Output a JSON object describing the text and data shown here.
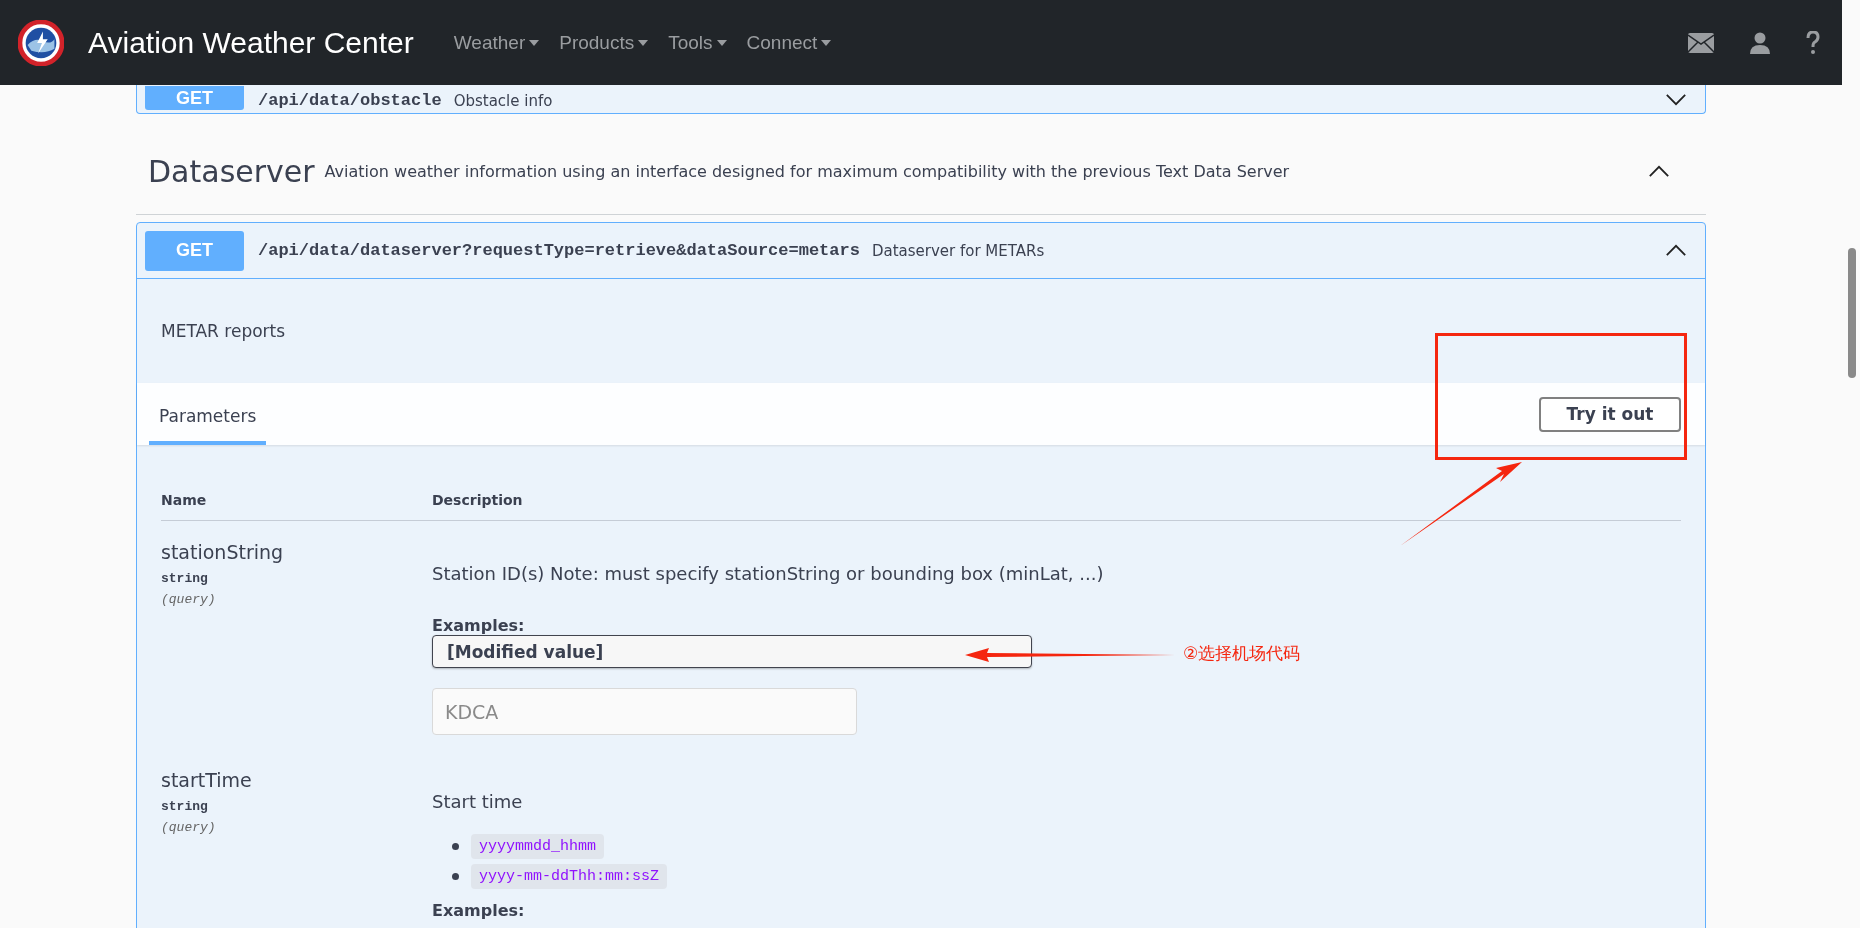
{
  "navbar": {
    "title": "Aviation Weather Center",
    "menus": [
      {
        "label": "Weather"
      },
      {
        "label": "Products"
      },
      {
        "label": "Tools"
      },
      {
        "label": "Connect"
      }
    ]
  },
  "collapsed_operation": {
    "method": "GET",
    "path": "/api/data/obstacle",
    "summary": "Obstacle info",
    "expanded": false
  },
  "section": {
    "title": "Dataserver",
    "description": "Aviation weather information using an interface designed for maximum compatibility with the previous Text Data Server",
    "expanded": true
  },
  "operation": {
    "method": "GET",
    "path": "/api/data/dataserver?requestType=retrieve&dataSource=metars",
    "summary": "Dataserver for METARs",
    "expanded": true,
    "description": "METAR reports",
    "tabs": [
      {
        "label": "Parameters",
        "selected": true
      }
    ],
    "try_button": "Try it out",
    "columns": [
      "Name",
      "Description"
    ],
    "parameters": [
      {
        "name": "stationString",
        "type": "string",
        "location": "(query)",
        "description": "Station ID(s) Note: must specify stationString or bounding box (minLat, ...)",
        "examples_label": "Examples:",
        "example_select": "[Modified value]",
        "placeholder": "KDCA"
      },
      {
        "name": "startTime",
        "type": "string",
        "location": "(query)",
        "description": "Start time",
        "formats": [
          "yyyymmdd_hhmm",
          "yyyy-mm-ddThh:mm:ssZ"
        ],
        "examples_label": "Examples:"
      }
    ]
  },
  "annotations": [
    {
      "kind": "box"
    },
    {
      "kind": "arrow"
    },
    {
      "kind": "labeled_arrow",
      "label": "②选择机场代码"
    }
  ]
}
